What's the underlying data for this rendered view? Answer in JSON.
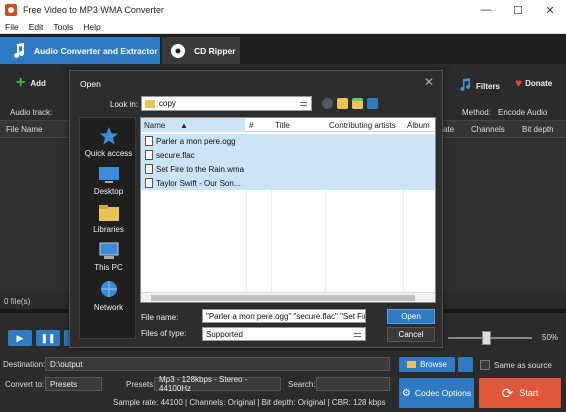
{
  "window": {
    "title": "Free Video to MP3 WMA Converter",
    "minimize": "—",
    "maximize": "☐",
    "close": "✕"
  },
  "menu": [
    "File",
    "Edit",
    "Tools",
    "Help"
  ],
  "tabs": [
    {
      "label": "Audio Converter and Extractor",
      "active": true
    },
    {
      "label": "CD Ripper",
      "active": false
    }
  ],
  "toolbar": {
    "add_label": "Add",
    "filters_label": "Filters",
    "donate_label": "Donate"
  },
  "audio_track_label": "Audio track:",
  "method": {
    "label": "Method:",
    "value": "Encode Audio"
  },
  "columns_bg": [
    "File Name",
    "ate",
    "Channels",
    "Bit depth"
  ],
  "files_count": "0 file(s)",
  "volume": {
    "value_label": "50%",
    "level": 0.5
  },
  "bottom": {
    "destination_label": "Destination:",
    "destination_value": "D:\\output",
    "browse_label": "Browse",
    "same_as_source_label": "Same as source",
    "convert_to_label": "Convert to:",
    "convert_to_value": "Presets",
    "presets_label": "Presets:",
    "presets_value": "Mp3 - 128kbps - Stereo - 44100Hz",
    "search_label": "Search:",
    "codec_options_label": "Codec Options",
    "start_label": "Start",
    "status_line": "Sample rate: 44100 | Channels: Original | Bit depth: Original | CBR: 128 kbps"
  },
  "dialog": {
    "title": "Open",
    "close": "✕",
    "look_in_label": "Look in:",
    "look_in_value": "copy",
    "places": [
      "Quick access",
      "Desktop",
      "Libraries",
      "This PC",
      "Network"
    ],
    "columns": [
      "Name",
      "#",
      "Title",
      "Contributing artists",
      "Album"
    ],
    "files": [
      {
        "name": "Parler a mon pere.ogg",
        "selected": true
      },
      {
        "name": "secure.flac",
        "selected": true
      },
      {
        "name": "Set Fire to the Rain.wma",
        "selected": true
      },
      {
        "name": "Taylor Swift - Our Son...",
        "selected": true
      }
    ],
    "file_name_label": "File name:",
    "file_name_value": "\"Parler a mon pere.ogg\" \"secure.flac\" \"Set Fire",
    "files_of_type_label": "Files of type:",
    "files_of_type_value": "Supported",
    "open_label": "Open",
    "cancel_label": "Cancel"
  },
  "colors": {
    "accent": "#2e7bc4",
    "start": "#e0563a",
    "bg": "#2b2b2b",
    "selection": "#cce4f7"
  }
}
